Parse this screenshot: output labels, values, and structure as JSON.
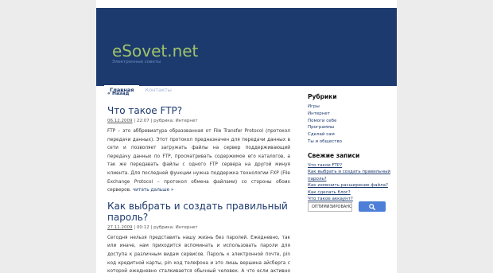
{
  "site": {
    "title": "eSovet.net",
    "tagline": "Электронные советы"
  },
  "nav": {
    "items": [
      {
        "label": "Главная"
      },
      {
        "label": "Контакты"
      }
    ]
  },
  "back_link": "« Назад",
  "posts": [
    {
      "title": "Что такое FTP?",
      "date": "06.12.2009",
      "time": "22:07",
      "category_prefix": "рубрика:",
      "category": "Интернет",
      "body": "FTP – это аббревиатура образованная от File Transfer Protocol (протокол передачи данных). Этот протокол предназначен для передачи данных в сети и позволяет загружать файлы на сервер поддерживающий передачу данных по FTP, просматривать содержимое его каталогов, а так же передавать файлы с одного FTP сервера на другой минуя клиента. Для последней функции нужна поддержка технологии FXP (File Exchange Protocol – протокол обмена файлами) со стороны обоих серверов.",
      "more": "читать дальше »"
    },
    {
      "title": "Как выбрать и создать правильный пароль?",
      "date": "27.11.2009",
      "time": "00:12",
      "category_prefix": "рубрика:",
      "category": "Интернет",
      "body": "Сегодня нельзя представить нашу жизнь без паролей. Ежедневно, так или иначе, нам приходится вспоминать и использовать пароли для доступа к различным видам сервисов. Пароль к электронной почте, pin код кредитной карты, pin код телефона и это лишь вершина айсберга с которой ежедневно сталкивается обычный человек. А что если активно использует интернет, то"
    }
  ],
  "sidebar": {
    "rubrics_title": "Рубрики",
    "rubrics": [
      "Игры",
      "Интернет",
      "Помоги себе",
      "Программы",
      "Сделай сам",
      "Ты и общество"
    ],
    "recent_title": "Свежие записи",
    "recent": [
      "Что такое FTP?",
      "Как выбрать и создать правильный пароль?",
      "Как изменить расширение файла?",
      "Как сделать блог?",
      "Что такое аккаунт?"
    ]
  },
  "search": {
    "value": "ОПТИМИЗИРОВАНО",
    "button_icon": "search-icon"
  },
  "colors": {
    "header": "#1d3a6e",
    "title": "#9ec36a",
    "search_button": "#4d7fd9"
  }
}
